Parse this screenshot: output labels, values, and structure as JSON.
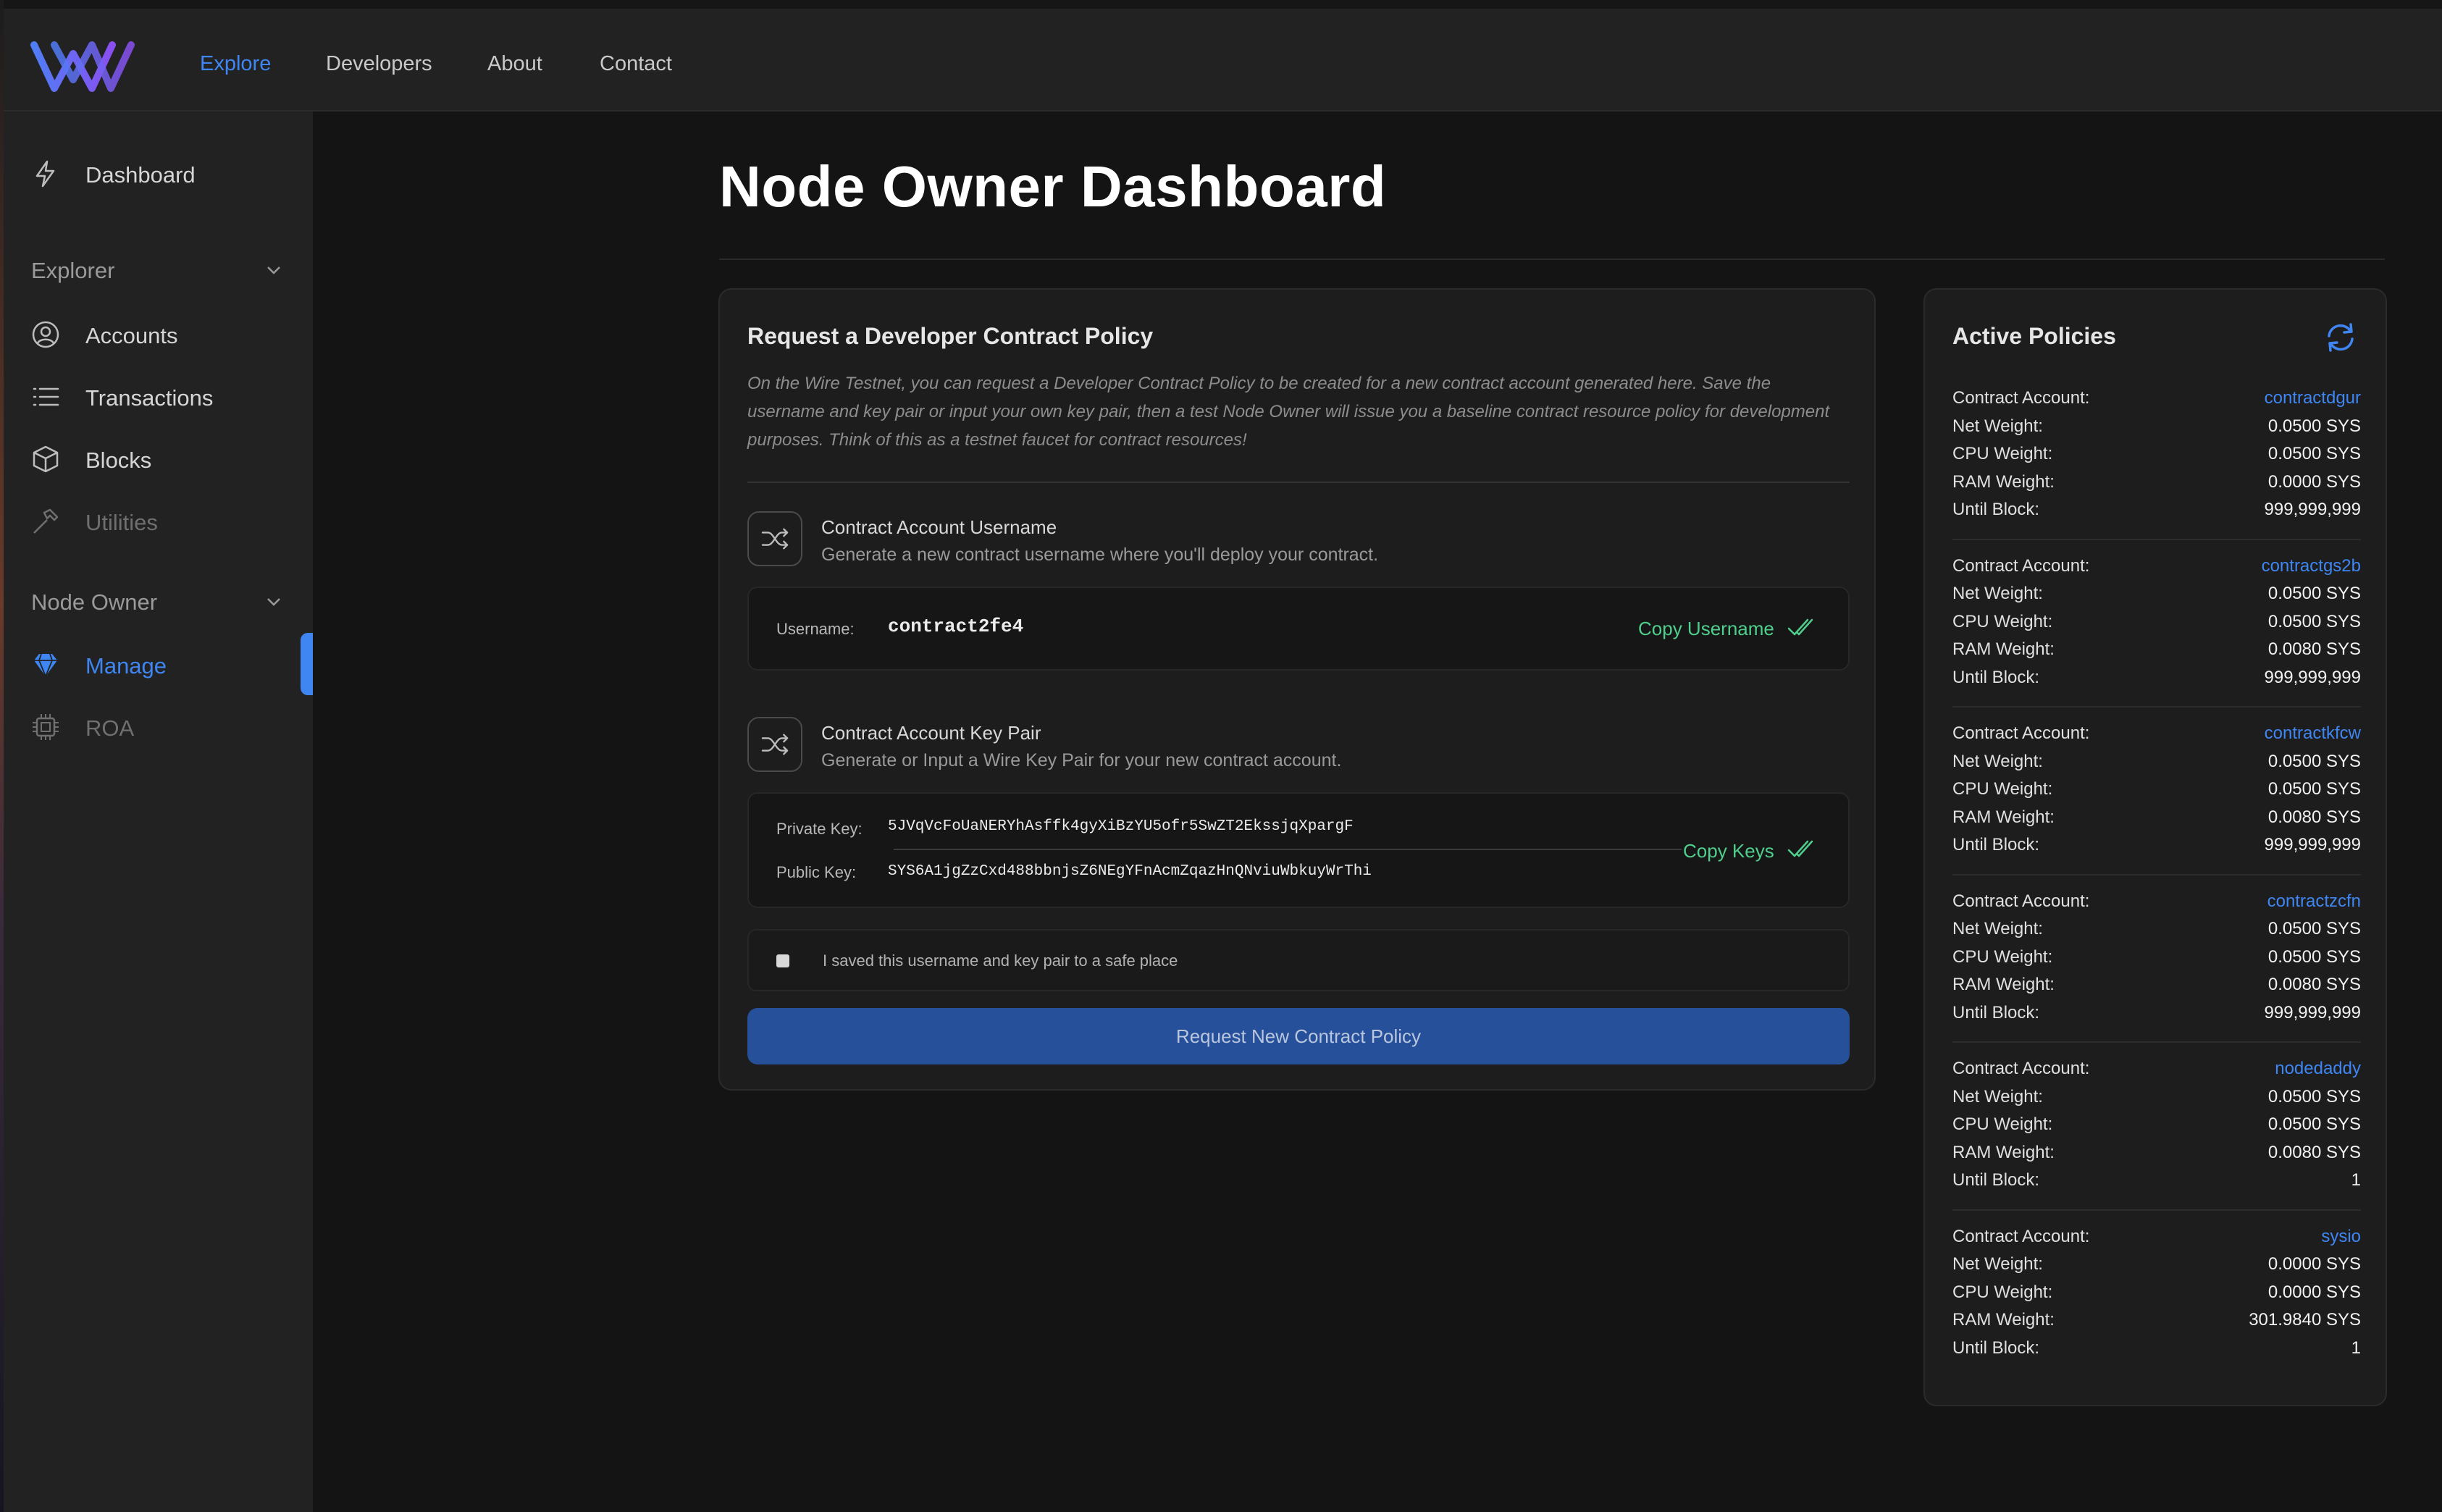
{
  "header": {
    "nav": [
      "Explore",
      "Developers",
      "About",
      "Contact"
    ],
    "active_index": 0,
    "accent": "#3f86f2"
  },
  "sidebar": {
    "dashboard": "Dashboard",
    "sections": [
      {
        "label": "Explorer",
        "items": [
          "Accounts",
          "Transactions",
          "Blocks",
          "Utilities"
        ]
      },
      {
        "label": "Node Owner",
        "items": [
          "Manage",
          "ROA"
        ]
      }
    ],
    "active_item": "Manage",
    "icons": [
      "lightning-icon",
      "user-circle-icon",
      "list-icon",
      "cube-icon",
      "hammer-icon",
      "diamond-icon",
      "chip-icon"
    ]
  },
  "page": {
    "title": "Node Owner Dashboard"
  },
  "request": {
    "title": "Request a Developer Contract Policy",
    "description": "On the Wire Testnet, you can request a Developer Contract Policy to be created for a new contract account generated here. Save the username and key pair or input your own key pair, then a test Node Owner will issue you a baseline contract resource policy for development purposes. Think of this as a testnet faucet for contract resources!",
    "username_section": {
      "title": "Contract Account Username",
      "subtitle": "Generate a new contract username where you'll deploy your contract.",
      "label": "Username:",
      "value": "contract2fe4",
      "copy": "Copy Username"
    },
    "keypair_section": {
      "title": "Contract Account Key Pair",
      "subtitle": "Generate or Input a Wire Key Pair for your new contract account.",
      "private_label": "Private Key:",
      "private_value": "5JVqVcFoUaNERYhAsffk4gyXiBzYU5ofr5SwZT2EkssjqXpargF",
      "public_label": "Public Key:",
      "public_value": "SYS6A1jgZzCxd488bbnjsZ6NEgYFnAcmZqazHnQNviuWbkuyWrThi",
      "copy": "Copy Keys"
    },
    "checkbox_label": "I saved this username and key pair to a safe place",
    "submit": "Request New Contract Policy"
  },
  "policies": {
    "title": "Active Policies",
    "labels": {
      "account": "Contract Account:",
      "net": "Net Weight:",
      "cpu": "CPU Weight:",
      "ram": "RAM Weight:",
      "until": "Until Block:"
    },
    "items": [
      {
        "account": "contractdgur",
        "net": "0.0500 SYS",
        "cpu": "0.0500 SYS",
        "ram": "0.0000 SYS",
        "until": "999,999,999"
      },
      {
        "account": "contractgs2b",
        "net": "0.0500 SYS",
        "cpu": "0.0500 SYS",
        "ram": "0.0080 SYS",
        "until": "999,999,999"
      },
      {
        "account": "contractkfcw",
        "net": "0.0500 SYS",
        "cpu": "0.0500 SYS",
        "ram": "0.0080 SYS",
        "until": "999,999,999"
      },
      {
        "account": "contractzcfn",
        "net": "0.0500 SYS",
        "cpu": "0.0500 SYS",
        "ram": "0.0080 SYS",
        "until": "999,999,999"
      },
      {
        "account": "nodedaddy",
        "net": "0.0500 SYS",
        "cpu": "0.0500 SYS",
        "ram": "0.0080 SYS",
        "until": "1"
      },
      {
        "account": "sysio",
        "net": "0.0000 SYS",
        "cpu": "0.0000 SYS",
        "ram": "301.9840 SYS",
        "until": "1"
      }
    ]
  }
}
